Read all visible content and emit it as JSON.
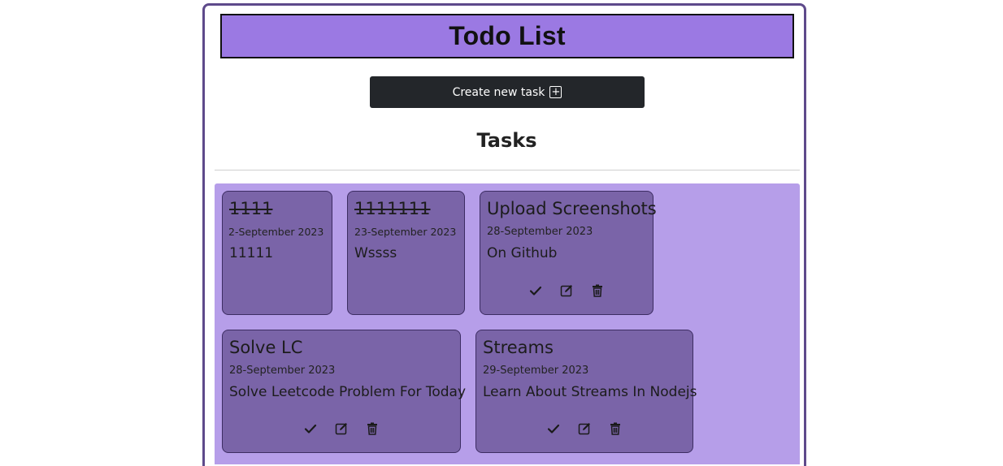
{
  "header": {
    "title": "Todo List"
  },
  "create_button": {
    "label": "Create new task",
    "icon": "plus-square-icon"
  },
  "tasks_heading": "Tasks",
  "colors": {
    "title_bar": "#9b79e3",
    "tasks_area": "#b69ee9",
    "card": "#7a64a8",
    "button": "#23262a",
    "frame": "#5e4a8b"
  },
  "tasks": [
    {
      "title": "1111",
      "date": "2-September 2023",
      "description": "11111",
      "completed": true
    },
    {
      "title": "1111111",
      "date": "23-September 2023",
      "description": "Wssss",
      "completed": true
    },
    {
      "title": "Upload Screenshots",
      "date": "28-September 2023",
      "description": "On Github",
      "completed": false
    },
    {
      "title": "Solve LC",
      "date": "28-September 2023",
      "description": "Solve Leetcode Problem For Today",
      "completed": false
    },
    {
      "title": "Streams",
      "date": "29-September 2023",
      "description": "Learn About Streams In Nodejs",
      "completed": false
    }
  ]
}
